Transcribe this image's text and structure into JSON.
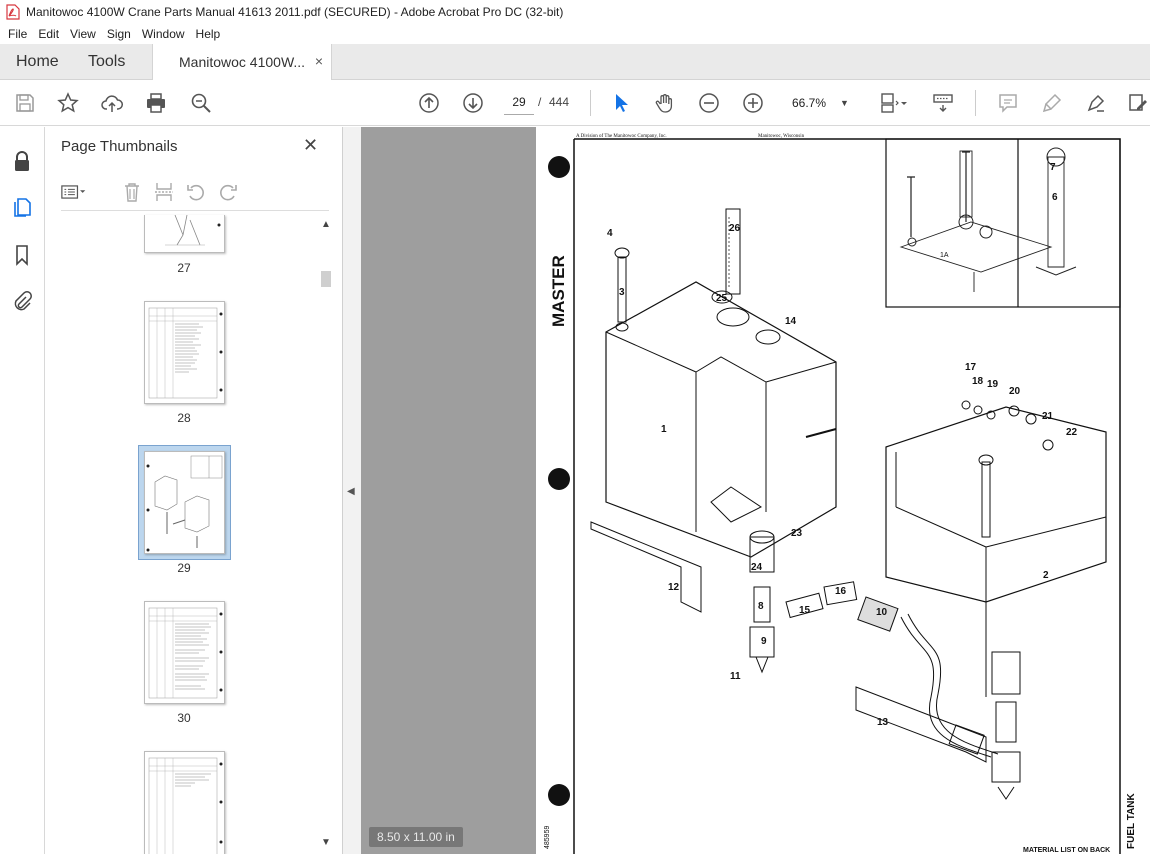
{
  "window": {
    "title": "Manitowoc 4100W Crane Parts Manual 41613 2011.pdf (SECURED) - Adobe Acrobat Pro DC (32-bit)"
  },
  "menu": [
    "File",
    "Edit",
    "View",
    "Sign",
    "Window",
    "Help"
  ],
  "tabs": {
    "home": "Home",
    "tools": "Tools",
    "document": "Manitowoc 4100W...",
    "close_glyph": "×"
  },
  "toolbar": {
    "current_page": "29",
    "page_separator": "/",
    "total_pages": "444",
    "zoom": "66.7%",
    "zoom_arrow": "▼"
  },
  "thumbnails": {
    "panel_title": "Page Thumbnails",
    "close_glyph": "✕",
    "pages": [
      "27",
      "28",
      "29",
      "30"
    ],
    "selected_page": "29"
  },
  "document": {
    "page_size": "8.50 x 11.00 in",
    "header_left": "A Division of The Manitowoc Company, Inc.",
    "header_right": "Manitowoc, Wisconsin",
    "stamp": "MASTER",
    "detail_label": "1A",
    "side_number": "485959",
    "footer": "MATERIAL LIST ON BACK",
    "side_title": "FUEL TANK",
    "callouts": [
      "1",
      "2",
      "3",
      "4",
      "6",
      "7",
      "8",
      "9",
      "10",
      "11",
      "12",
      "13",
      "14",
      "15",
      "16",
      "17",
      "18",
      "19",
      "20",
      "21",
      "22",
      "23",
      "24",
      "25",
      "26"
    ]
  },
  "colors": {
    "accent_blue": "#1473e6",
    "selection_fill": "#bcd6ee",
    "doc_background": "#9e9e9e",
    "acrobat_red": "#d7373f"
  }
}
